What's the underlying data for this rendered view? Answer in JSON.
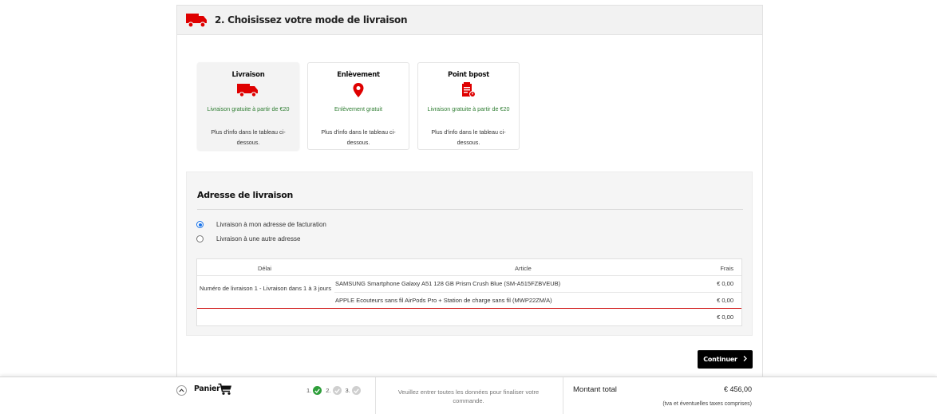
{
  "section": {
    "title": "2. Choisissez votre mode de livraison"
  },
  "options": [
    {
      "title": "Livraison",
      "promo": "Livraison gratuite à partir de €20",
      "info": "Plus d'info dans le tableau ci-dessous.",
      "icon": "truck-icon"
    },
    {
      "title": "Enlèvement",
      "promo": "Enlèvement gratuit",
      "info": "Plus d'info dans le tableau ci-dessous.",
      "icon": "location-pin-icon"
    },
    {
      "title": "Point bpost",
      "promo": "Livraison gratuite à partir de €20",
      "info": "Plus d'info dans le tableau ci-dessous.",
      "icon": "parcel-point-icon"
    }
  ],
  "address": {
    "title": "Adresse de livraison",
    "option_billing": "Livraison à mon adresse de facturation",
    "option_other": "Livraison à une autre adresse"
  },
  "table": {
    "headers": {
      "delay": "Délai",
      "article": "Article",
      "fees": "Frais"
    },
    "delivery": "Numéro de livraison 1 - Livraison dans 1 à 3 jours",
    "items": [
      {
        "article": "SAMSUNG Smartphone Galaxy A51 128 GB Prism Crush Blue (SM-A515FZBVEUB)",
        "fee": "€ 0,00"
      },
      {
        "article": "APPLE Ecouteurs sans fil AirPods Pro + Station de charge sans fil (MWP22ZM/A)",
        "fee": "€ 0,00"
      }
    ],
    "total_fee": "€ 0,00"
  },
  "continue_label": "Continuer",
  "footer": {
    "cart_label": "Panier",
    "steps": [
      "1.",
      "2.",
      "3."
    ],
    "message": "Veuillez entrer toutes les données pour finaliser votre commande.",
    "total_label": "Montant total",
    "total_value": "€ 456,00",
    "tax_note": "(tva et éventuelles taxes comprises)"
  },
  "colors": {
    "brand_red": "#df0000",
    "promo_green": "#2e7d32",
    "radio_blue": "#1a73e8",
    "step_done": "#2e9e3a"
  }
}
